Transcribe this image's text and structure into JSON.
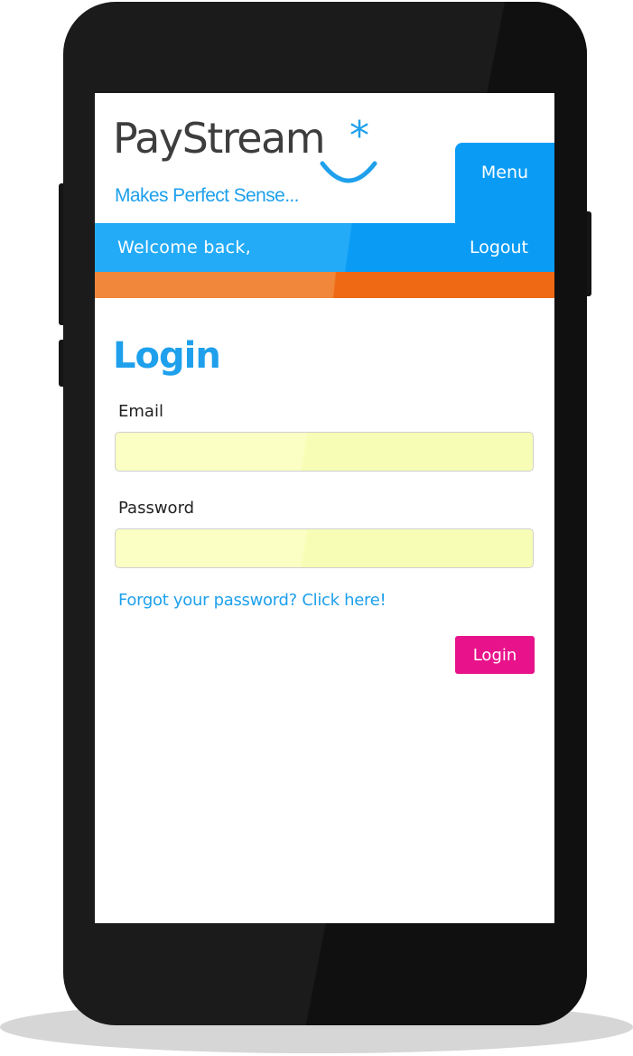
{
  "brand": {
    "name": "PayStream",
    "star": "*",
    "tagline": "Makes Perfect Sense...",
    "primary_color": "#1ea0ec",
    "accent_orange": "#ef6914",
    "login_button_color": "#e8128b"
  },
  "header": {
    "menu_label": "Menu",
    "welcome_text": "Welcome back,",
    "logout_label": "Logout"
  },
  "form": {
    "title": "Login",
    "email_label": "Email",
    "email_value": "",
    "password_label": "Password",
    "password_value": "",
    "forgot_link": "Forgot your password? Click here!",
    "submit_label": "Login"
  },
  "icons": {
    "logo_smile": "smile-icon"
  }
}
